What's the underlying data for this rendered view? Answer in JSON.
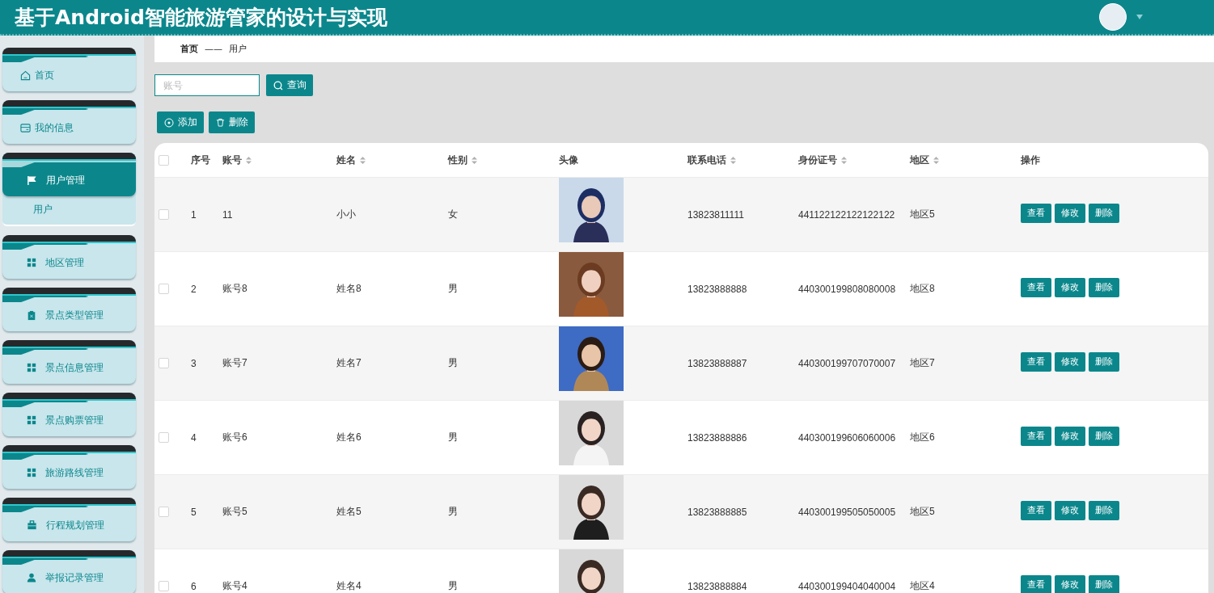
{
  "header": {
    "title": "基于Android智能旅游管家的设计与实现"
  },
  "sidebar": {
    "items": [
      {
        "label": "首页",
        "selected": false
      },
      {
        "label": "我的信息",
        "selected": false
      },
      {
        "label": "用户管理",
        "selected": true,
        "children": [
          {
            "label": "用户",
            "selected": false
          }
        ]
      },
      {
        "label": "地区管理",
        "selected": false
      },
      {
        "label": "景点类型管理",
        "selected": false
      },
      {
        "label": "景点信息管理",
        "selected": false
      },
      {
        "label": "景点购票管理",
        "selected": false
      },
      {
        "label": "旅游路线管理",
        "selected": false
      },
      {
        "label": "行程规划管理",
        "selected": false
      },
      {
        "label": "举报记录管理",
        "selected": false
      }
    ]
  },
  "breadcrumb": {
    "items": [
      "首页",
      "用户"
    ],
    "separator": "——"
  },
  "search": {
    "placeholder": "账号",
    "button": "查询"
  },
  "actions": [
    "添加",
    "删除"
  ],
  "table": {
    "all_checked": false,
    "columns": [
      {
        "label": "序号"
      },
      {
        "label": "账号",
        "sortable": true
      },
      {
        "label": "姓名",
        "sortable": true
      },
      {
        "label": "性别",
        "sortable": true
      },
      {
        "label": "头像"
      },
      {
        "label": "联系电话",
        "sortable": true
      },
      {
        "label": "身份证号",
        "sortable": true
      },
      {
        "label": "地区",
        "sortable": true
      },
      {
        "label": "操作"
      }
    ],
    "rows": [
      {
        "checked": false,
        "cells": [
          "1",
          "11",
          "小小",
          "女",
          {
            "kind": "picture"
          },
          "13823811111",
          "441122122122122122",
          "地区5",
          {
            "kind": "actions",
            "buttons": [
              "查看",
              "修改",
              "删除"
            ]
          }
        ]
      },
      {
        "checked": false,
        "cells": [
          "2",
          "账号8",
          "姓名8",
          "男",
          {
            "kind": "picture"
          },
          "13823888888",
          "440300199808080008",
          "地区8",
          {
            "kind": "actions",
            "buttons": [
              "查看",
              "修改",
              "删除"
            ]
          }
        ]
      },
      {
        "checked": false,
        "cells": [
          "3",
          "账号7",
          "姓名7",
          "男",
          {
            "kind": "picture"
          },
          "13823888887",
          "440300199707070007",
          "地区7",
          {
            "kind": "actions",
            "buttons": [
              "查看",
              "修改",
              "删除"
            ]
          }
        ]
      },
      {
        "checked": false,
        "cells": [
          "4",
          "账号6",
          "姓名6",
          "男",
          {
            "kind": "picture"
          },
          "13823888886",
          "440300199606060006",
          "地区6",
          {
            "kind": "actions",
            "buttons": [
              "查看",
              "修改",
              "删除"
            ]
          }
        ]
      },
      {
        "checked": false,
        "cells": [
          "5",
          "账号5",
          "姓名5",
          "男",
          {
            "kind": "picture"
          },
          "13823888885",
          "440300199505050005",
          "地区5",
          {
            "kind": "actions",
            "buttons": [
              "查看",
              "修改",
              "删除"
            ]
          }
        ]
      },
      {
        "checked": false,
        "cells": [
          "6",
          "账号4",
          "姓名4",
          "男",
          {
            "kind": "picture"
          },
          "13823888884",
          "440300199404040004",
          "地区4",
          {
            "kind": "actions",
            "buttons": [
              "查看",
              "修改",
              "删除"
            ]
          }
        ]
      }
    ]
  }
}
